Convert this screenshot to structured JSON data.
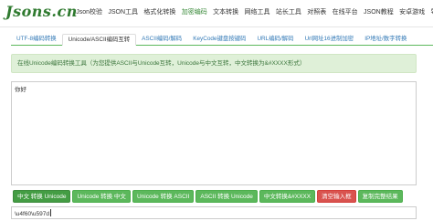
{
  "header": {
    "logo": "Jsons.cn",
    "nav": [
      {
        "label": "Json校验",
        "active": false
      },
      {
        "label": "JSON工具",
        "active": false
      },
      {
        "label": "格式化转换",
        "active": false
      },
      {
        "label": "加密编码",
        "active": true
      },
      {
        "label": "文本转换",
        "active": false
      },
      {
        "label": "网络工具",
        "active": false
      },
      {
        "label": "站长工具",
        "active": false
      },
      {
        "label": "对照表",
        "active": false
      },
      {
        "label": "在线平台",
        "active": false
      },
      {
        "label": "JSON教程",
        "active": false
      },
      {
        "label": "安卓游戏",
        "active": false
      },
      {
        "label": "导航",
        "active": false
      }
    ]
  },
  "tabs": [
    {
      "label": "UTF-8编码转换",
      "active": false
    },
    {
      "label": "Unicode/ASCII编码互转",
      "active": true
    },
    {
      "label": "ASCII编码/解码",
      "active": false
    },
    {
      "label": "KeyCode键盘按键码",
      "active": false
    },
    {
      "label": "URL编码/解码",
      "active": false
    },
    {
      "label": "Url网址16进制加密",
      "active": false
    },
    {
      "label": "IP地址/数字转换",
      "active": false
    }
  ],
  "notice": "在线Unicode编码转换工具（为您提供ASCII与Unicode互转，Unicode与中文互转，中文转换为&#XXXX形式）",
  "input": {
    "value": "你好"
  },
  "buttons": [
    {
      "label": "中文 转换 Unicode",
      "style": "first"
    },
    {
      "label": "Unicode 转换 中文",
      "style": "green"
    },
    {
      "label": "Unicode 转换 ASCII",
      "style": "green"
    },
    {
      "label": "ASCII 转换 Unicode",
      "style": "green"
    },
    {
      "label": "中文转换&#XXXX",
      "style": "green"
    },
    {
      "label": "清空输入框",
      "style": "red"
    },
    {
      "label": "复制完整结果",
      "style": "green"
    }
  ],
  "output": {
    "value": "\\u4f60\\u597d"
  },
  "colors": {
    "primary_green": "#5cb85c",
    "notice_bg": "#dff0d8",
    "danger_red": "#d9534f",
    "logo_green": "#2f7a2f"
  }
}
